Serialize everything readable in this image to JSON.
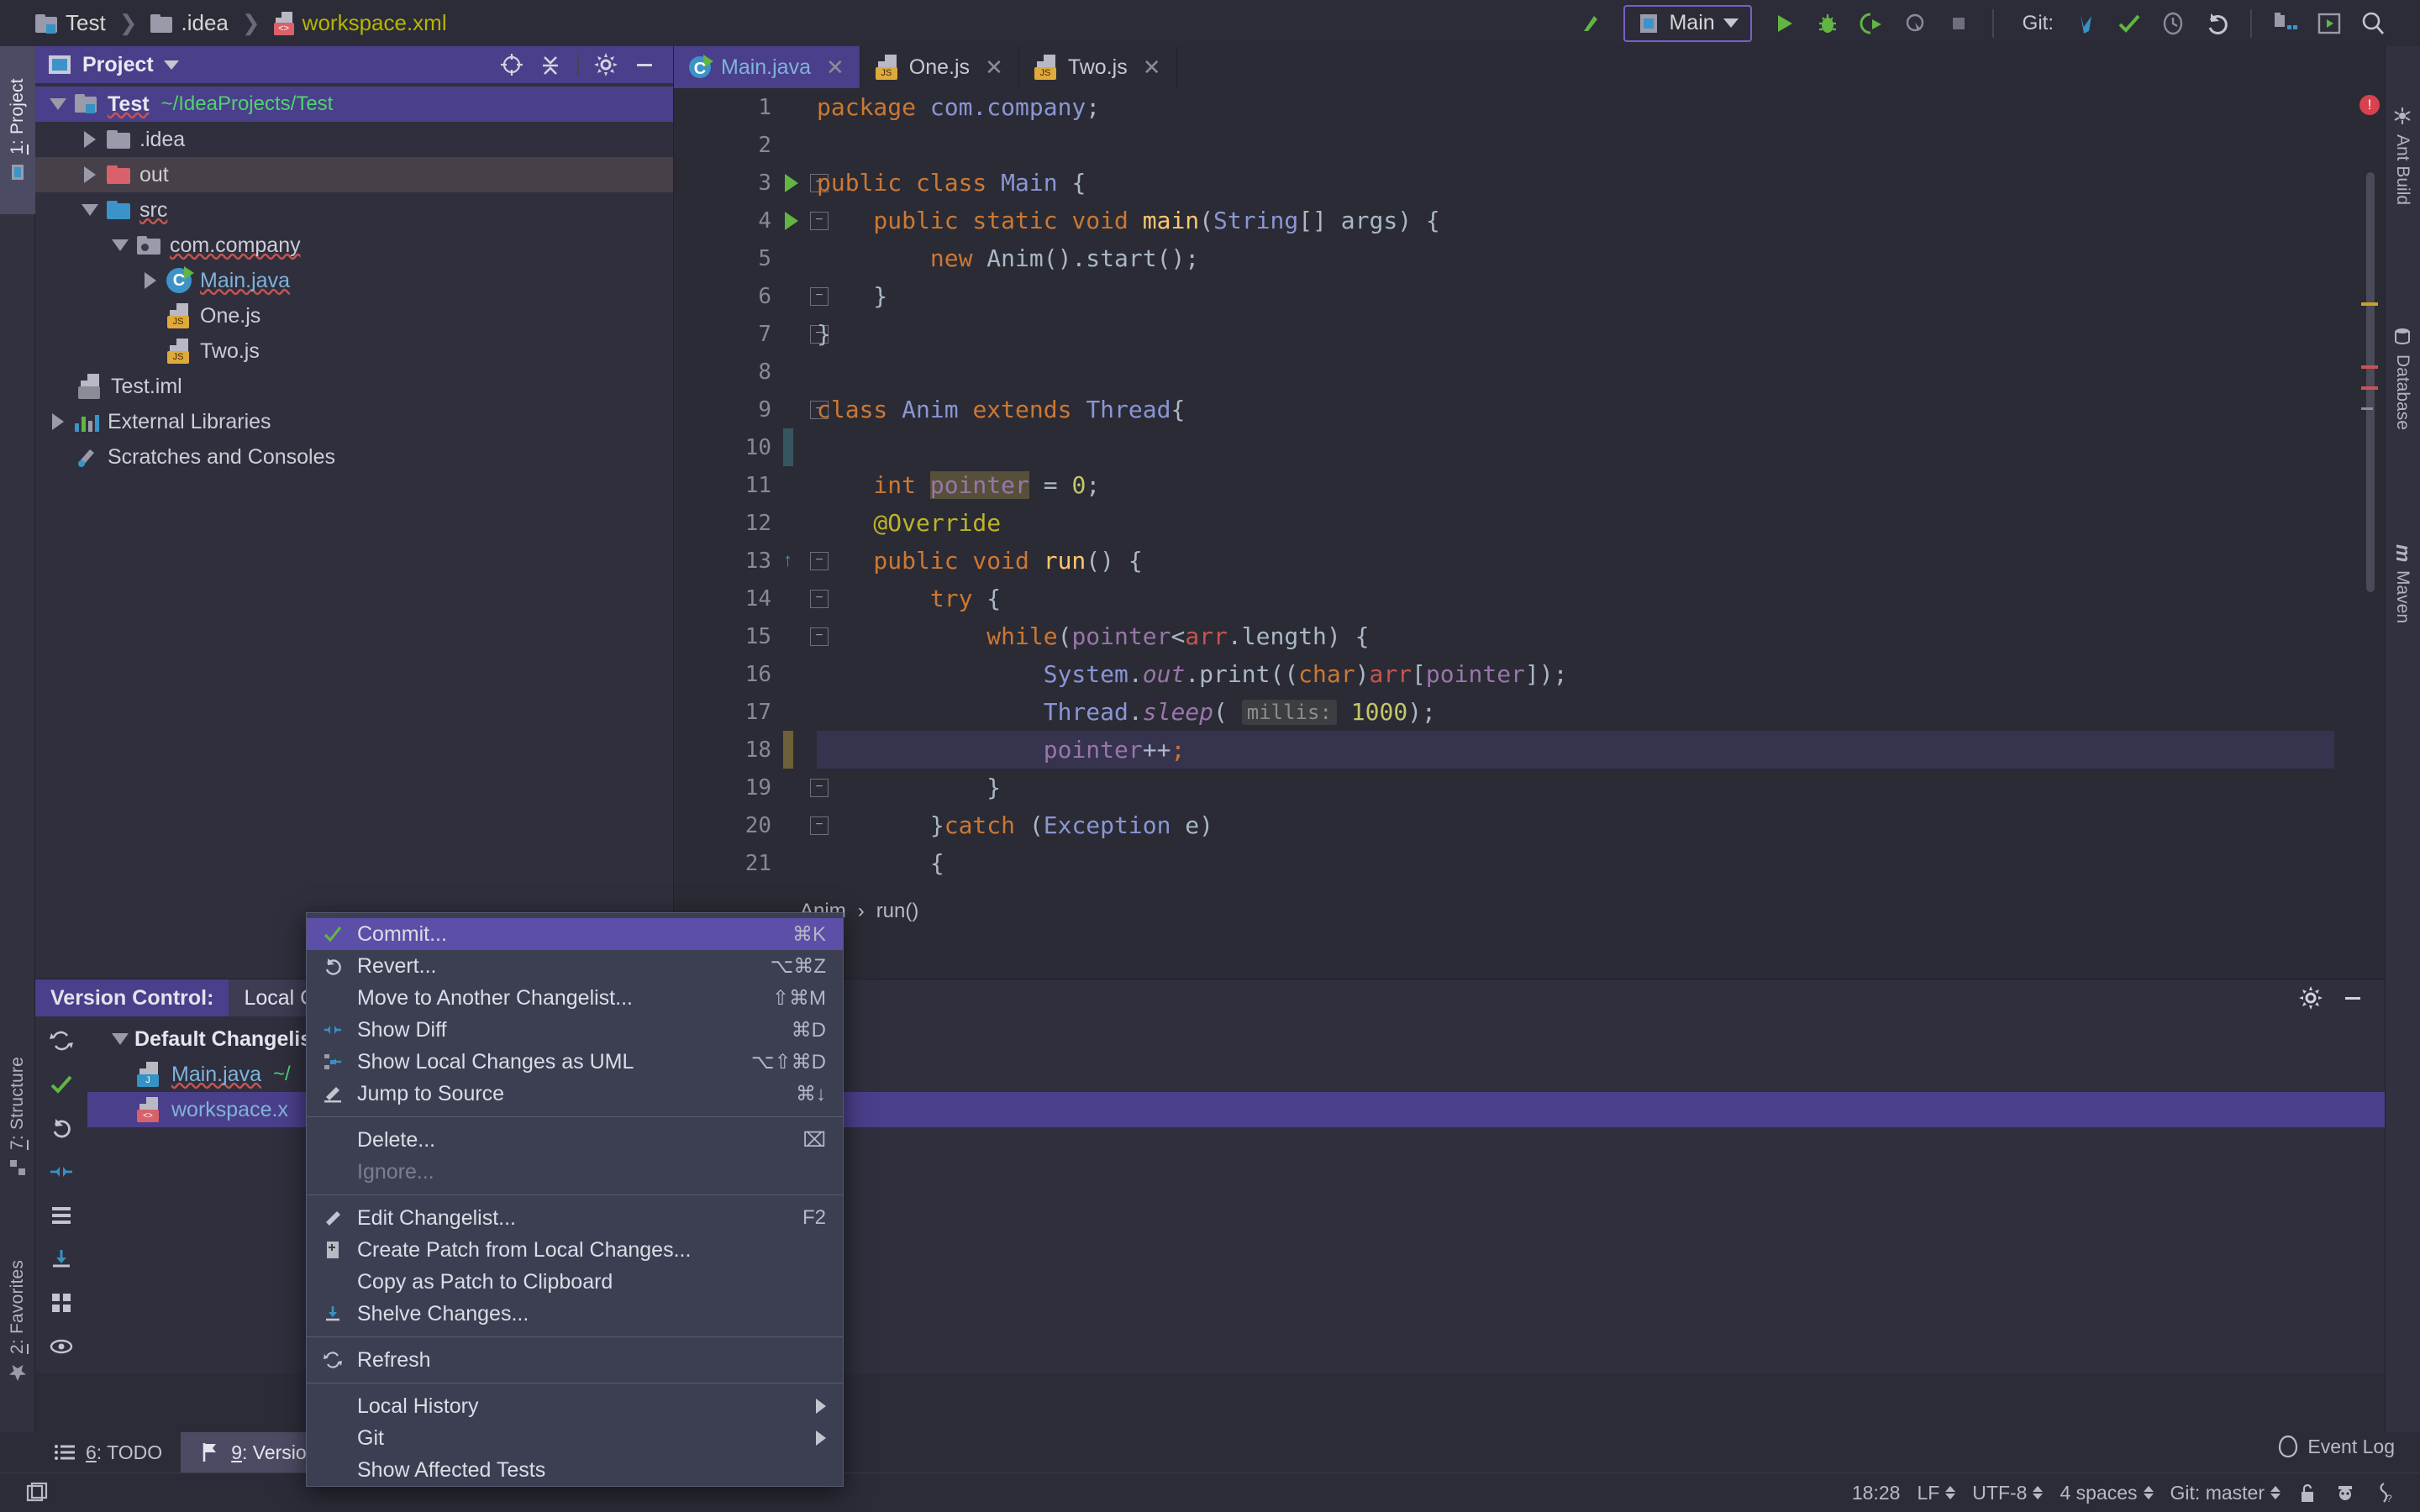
{
  "breadcrumb": {
    "items": [
      {
        "label": "Test",
        "icon": "module-folder-icon",
        "kind": "module"
      },
      {
        "label": ".idea",
        "icon": "folder-icon",
        "kind": "folder"
      },
      {
        "label": "workspace.xml",
        "icon": "xml-file-icon",
        "kind": "xml"
      }
    ],
    "separator": "❯"
  },
  "toolbar": {
    "back_label": "↖",
    "run_config": "Main",
    "run_label": "Run",
    "debug_label": "Debug",
    "run_coverage_label": "Run with Coverage",
    "profile_label": "Profile",
    "stop_label": "Stop",
    "git_label": "Git:",
    "update_label": "Update Project",
    "commit_label": "Commit",
    "history_label": "History",
    "rollback_label": "Rollback",
    "project_structure_label": "Project Structure",
    "plugins_label": "Plugins",
    "search_label": "Search Everywhere"
  },
  "left_strip": {
    "tabs": [
      {
        "num": "1",
        "label": "Project",
        "active": true
      },
      {
        "num": "7",
        "label": "Structure",
        "active": false
      },
      {
        "num": "2",
        "label": "Favorites",
        "active": false
      }
    ]
  },
  "right_strip": {
    "tabs": [
      {
        "label": "Ant Build",
        "icon": "ant-icon"
      },
      {
        "label": "Database",
        "icon": "database-icon"
      },
      {
        "label": "Maven",
        "icon": "maven-icon"
      }
    ]
  },
  "project_panel": {
    "title": "Project",
    "buttons": [
      "locate-icon",
      "collapse-all-icon",
      "settings-icon",
      "hide-icon"
    ],
    "tree": [
      {
        "label": "Test",
        "path": "~/IdeaProjects/Test",
        "depth": 0,
        "twist": "down",
        "icon": "module-folder",
        "selected": true,
        "bold": true,
        "wavy": true
      },
      {
        "label": ".idea",
        "path": "",
        "depth": 1,
        "twist": "right",
        "icon": "folder-gray",
        "selected": false
      },
      {
        "label": "out",
        "path": "",
        "depth": 1,
        "twist": "right",
        "icon": "folder-red",
        "selected": false,
        "hover": true
      },
      {
        "label": "src",
        "path": "",
        "depth": 1,
        "twist": "down",
        "icon": "folder-blue",
        "selected": false,
        "wavy": true
      },
      {
        "label": "com.company",
        "path": "",
        "depth": 2,
        "twist": "down",
        "icon": "package",
        "selected": false,
        "wavy": true
      },
      {
        "label": "Main.java",
        "path": "",
        "depth": 3,
        "twist": "right",
        "icon": "java-class",
        "selected": false,
        "blue": true,
        "wavy": true
      },
      {
        "label": "One.js",
        "path": "",
        "depth": 4,
        "twist": "none",
        "icon": "js-file",
        "selected": false
      },
      {
        "label": "Two.js",
        "path": "",
        "depth": 4,
        "twist": "none",
        "icon": "js-file",
        "selected": false
      },
      {
        "label": "Test.iml",
        "path": "",
        "depth": 1,
        "twist": "none",
        "icon": "iml-file",
        "selected": false
      },
      {
        "label": "External Libraries",
        "path": "",
        "depth": 0,
        "twist": "right",
        "icon": "libraries",
        "selected": false
      },
      {
        "label": "Scratches and Consoles",
        "path": "",
        "depth": 0,
        "twist": "none",
        "icon": "scratches",
        "selected": false
      }
    ]
  },
  "editor": {
    "tabs": [
      {
        "label": "Main.java",
        "icon": "java-class-icon",
        "active": true
      },
      {
        "label": "One.js",
        "icon": "js-file-icon",
        "active": false
      },
      {
        "label": "Two.js",
        "icon": "js-file-icon",
        "active": false
      }
    ],
    "close_glyph": "✕",
    "breadcrumb": [
      "Anim",
      "run()"
    ],
    "breadcrumb_sep": "›",
    "current_line": 18,
    "lines": [
      {
        "n": 1,
        "tokens": [
          {
            "t": "package ",
            "c": "k"
          },
          {
            "t": "com.company",
            "c": "t"
          },
          {
            "t": ";",
            "c": "s"
          }
        ]
      },
      {
        "n": 2,
        "tokens": []
      },
      {
        "n": 3,
        "tokens": [
          {
            "t": "public class ",
            "c": "k"
          },
          {
            "t": "Main",
            "c": "t"
          },
          {
            "t": " {",
            "c": "s"
          }
        ],
        "run_marker": true,
        "fold": "start"
      },
      {
        "n": 4,
        "tokens": [
          {
            "t": "    public static void ",
            "c": "k"
          },
          {
            "t": "main",
            "c": "m"
          },
          {
            "t": "(",
            "c": "s"
          },
          {
            "t": "String",
            "c": "t"
          },
          {
            "t": "[] args) {",
            "c": "s"
          }
        ],
        "run_marker": true,
        "fold": "start"
      },
      {
        "n": 5,
        "tokens": [
          {
            "t": "        ",
            "c": "s"
          },
          {
            "t": "new ",
            "c": "k"
          },
          {
            "t": "Anim().start();",
            "c": "s"
          }
        ]
      },
      {
        "n": 6,
        "tokens": [
          {
            "t": "    }",
            "c": "s"
          }
        ],
        "fold": "end"
      },
      {
        "n": 7,
        "tokens": [
          {
            "t": "}",
            "c": "s"
          }
        ],
        "fold": "end"
      },
      {
        "n": 8,
        "tokens": []
      },
      {
        "n": 9,
        "tokens": [
          {
            "t": "class ",
            "c": "k"
          },
          {
            "t": "Anim",
            "c": "t"
          },
          {
            "t": " extends ",
            "c": "k"
          },
          {
            "t": "Thread",
            "c": "t"
          },
          {
            "t": "{",
            "c": "s"
          }
        ],
        "fold": "start"
      },
      {
        "n": 10,
        "tokens": []
      },
      {
        "n": 11,
        "tokens": [
          {
            "t": "    int ",
            "c": "k"
          },
          {
            "t": "pointer",
            "c": "f hl-ident"
          },
          {
            "t": " = ",
            "c": "s"
          },
          {
            "t": "0",
            "c": "n"
          },
          {
            "t": ";",
            "c": "s"
          }
        ]
      },
      {
        "n": 12,
        "tokens": [
          {
            "t": "    @Override",
            "c": "an"
          }
        ]
      },
      {
        "n": 13,
        "tokens": [
          {
            "t": "    public void ",
            "c": "k"
          },
          {
            "t": "run",
            "c": "m"
          },
          {
            "t": "() {",
            "c": "s"
          }
        ],
        "override_marker": true,
        "fold": "start"
      },
      {
        "n": 14,
        "tokens": [
          {
            "t": "        ",
            "c": "s"
          },
          {
            "t": "try",
            "c": "k"
          },
          {
            "t": " {",
            "c": "s"
          }
        ],
        "fold": "start"
      },
      {
        "n": 15,
        "tokens": [
          {
            "t": "            ",
            "c": "s"
          },
          {
            "t": "while",
            "c": "k"
          },
          {
            "t": "(",
            "c": "s"
          },
          {
            "t": "pointer",
            "c": "f"
          },
          {
            "t": "<",
            "c": "s"
          },
          {
            "t": "arr",
            "c": "r"
          },
          {
            "t": ".length) {",
            "c": "s"
          }
        ],
        "fold": "start"
      },
      {
        "n": 16,
        "tokens": [
          {
            "t": "                ",
            "c": "s"
          },
          {
            "t": "System",
            "c": "t"
          },
          {
            "t": ".",
            "c": "s"
          },
          {
            "t": "out",
            "c": "fi2"
          },
          {
            "t": ".print((",
            "c": "s"
          },
          {
            "t": "char",
            "c": "k"
          },
          {
            "t": ")",
            "c": "s"
          },
          {
            "t": "arr",
            "c": "r"
          },
          {
            "t": "[",
            "c": "s"
          },
          {
            "t": "pointer",
            "c": "f"
          },
          {
            "t": "]);",
            "c": "s"
          }
        ]
      },
      {
        "n": 17,
        "tokens": [
          {
            "t": "                ",
            "c": "s"
          },
          {
            "t": "Thread",
            "c": "t"
          },
          {
            "t": ".",
            "c": "s"
          },
          {
            "t": "sleep",
            "c": "fi2"
          },
          {
            "t": "( ",
            "c": "s"
          },
          {
            "t": "millis:",
            "c": "hint"
          },
          {
            "t": " ",
            "c": "s"
          },
          {
            "t": "1000",
            "c": "n"
          },
          {
            "t": ");",
            "c": "s"
          }
        ]
      },
      {
        "n": 18,
        "tokens": [
          {
            "t": "                ",
            "c": "s"
          },
          {
            "t": "pointer",
            "c": "f"
          },
          {
            "t": "++",
            "c": "s"
          },
          {
            "t": ";",
            "c": "k"
          }
        ],
        "highlight": true,
        "bulb": true
      },
      {
        "n": 19,
        "tokens": [
          {
            "t": "            }",
            "c": "s"
          }
        ],
        "fold": "end"
      },
      {
        "n": 20,
        "tokens": [
          {
            "t": "        }",
            "c": "s"
          },
          {
            "t": "catch",
            "c": "k"
          },
          {
            "t": " (",
            "c": "s"
          },
          {
            "t": "Exception",
            "c": "t"
          },
          {
            "t": " e)",
            "c": "s"
          }
        ],
        "fold": "end"
      },
      {
        "n": 21,
        "tokens": [
          {
            "t": "        {",
            "c": "s"
          }
        ]
      }
    ]
  },
  "vcs": {
    "title": "Version Control:",
    "subtab": "Local C",
    "changelist": "Default Changelis",
    "rows": [
      {
        "label": "Main.java",
        "path": "~/",
        "icon": "java-file-icon",
        "selected": false
      },
      {
        "label": "workspace.x",
        "path": "",
        "icon": "xml-file-icon",
        "selected": true
      }
    ],
    "toolbar_icons": [
      "refresh-icon",
      "commit-check-icon",
      "rollback-icon",
      "show-diff-icon",
      "group-icon",
      "shelve-icon",
      "expand-icon",
      "preview-icon"
    ]
  },
  "context_menu": {
    "groups": [
      {
        "items": [
          {
            "label": "Commit...",
            "accel": "⌘K",
            "icon": "check-icon",
            "active": true
          },
          {
            "label": "Revert...",
            "accel": "⌥⌘Z",
            "icon": "revert-icon"
          },
          {
            "label": "Move to Another Changelist...",
            "accel": "⇧⌘M",
            "icon": ""
          },
          {
            "label": "Show Diff",
            "accel": "⌘D",
            "icon": "diff-icon"
          },
          {
            "label": "Show Local Changes as UML",
            "accel": "⌥⇧⌘D",
            "icon": "uml-icon"
          },
          {
            "label": "Jump to Source",
            "accel": "⌘↓",
            "icon": "pencil-icon"
          }
        ]
      },
      {
        "items": [
          {
            "label": "Delete...",
            "accel": "⌧",
            "icon": ""
          },
          {
            "label": "Ignore...",
            "accel": "",
            "icon": "",
            "disabled": true
          }
        ]
      },
      {
        "items": [
          {
            "label": "Edit Changelist...",
            "accel": "F2",
            "icon": "pencil-icon"
          },
          {
            "label": "Create Patch from Local Changes...",
            "accel": "",
            "icon": "patch-icon"
          },
          {
            "label": "Copy as Patch to Clipboard",
            "accel": "",
            "icon": ""
          },
          {
            "label": "Shelve Changes...",
            "accel": "",
            "icon": "shelve-icon"
          }
        ]
      },
      {
        "items": [
          {
            "label": "Refresh",
            "accel": "",
            "icon": "refresh-icon"
          }
        ]
      },
      {
        "items": [
          {
            "label": "Local History",
            "accel": "",
            "icon": "",
            "submenu": true
          },
          {
            "label": "Git",
            "accel": "",
            "icon": "",
            "submenu": true
          },
          {
            "label": "Show Affected Tests",
            "accel": "",
            "icon": ""
          }
        ]
      }
    ]
  },
  "bottom_strip": {
    "tabs": [
      {
        "num": "6",
        "label": "TODO",
        "icon": "todo-icon",
        "active": false
      },
      {
        "num": "9",
        "label": "Version",
        "icon": "vcs-icon",
        "active": true
      }
    ]
  },
  "status_bar": {
    "event_log": "Event Log",
    "position": "18:28",
    "line_sep": "LF",
    "encoding": "UTF-8",
    "indent": "4 spaces",
    "branch": "Git: master",
    "icons": [
      "lock-icon",
      "hector-icon",
      "memory-icon"
    ]
  },
  "colors": {
    "accent_purple": "#4a3f8a",
    "menu_active": "#5c4fa8",
    "keyword_orange": "#cc7832",
    "type_blue": "#8a96d4",
    "green_path": "#4fd36e",
    "error_red": "#c75450"
  }
}
